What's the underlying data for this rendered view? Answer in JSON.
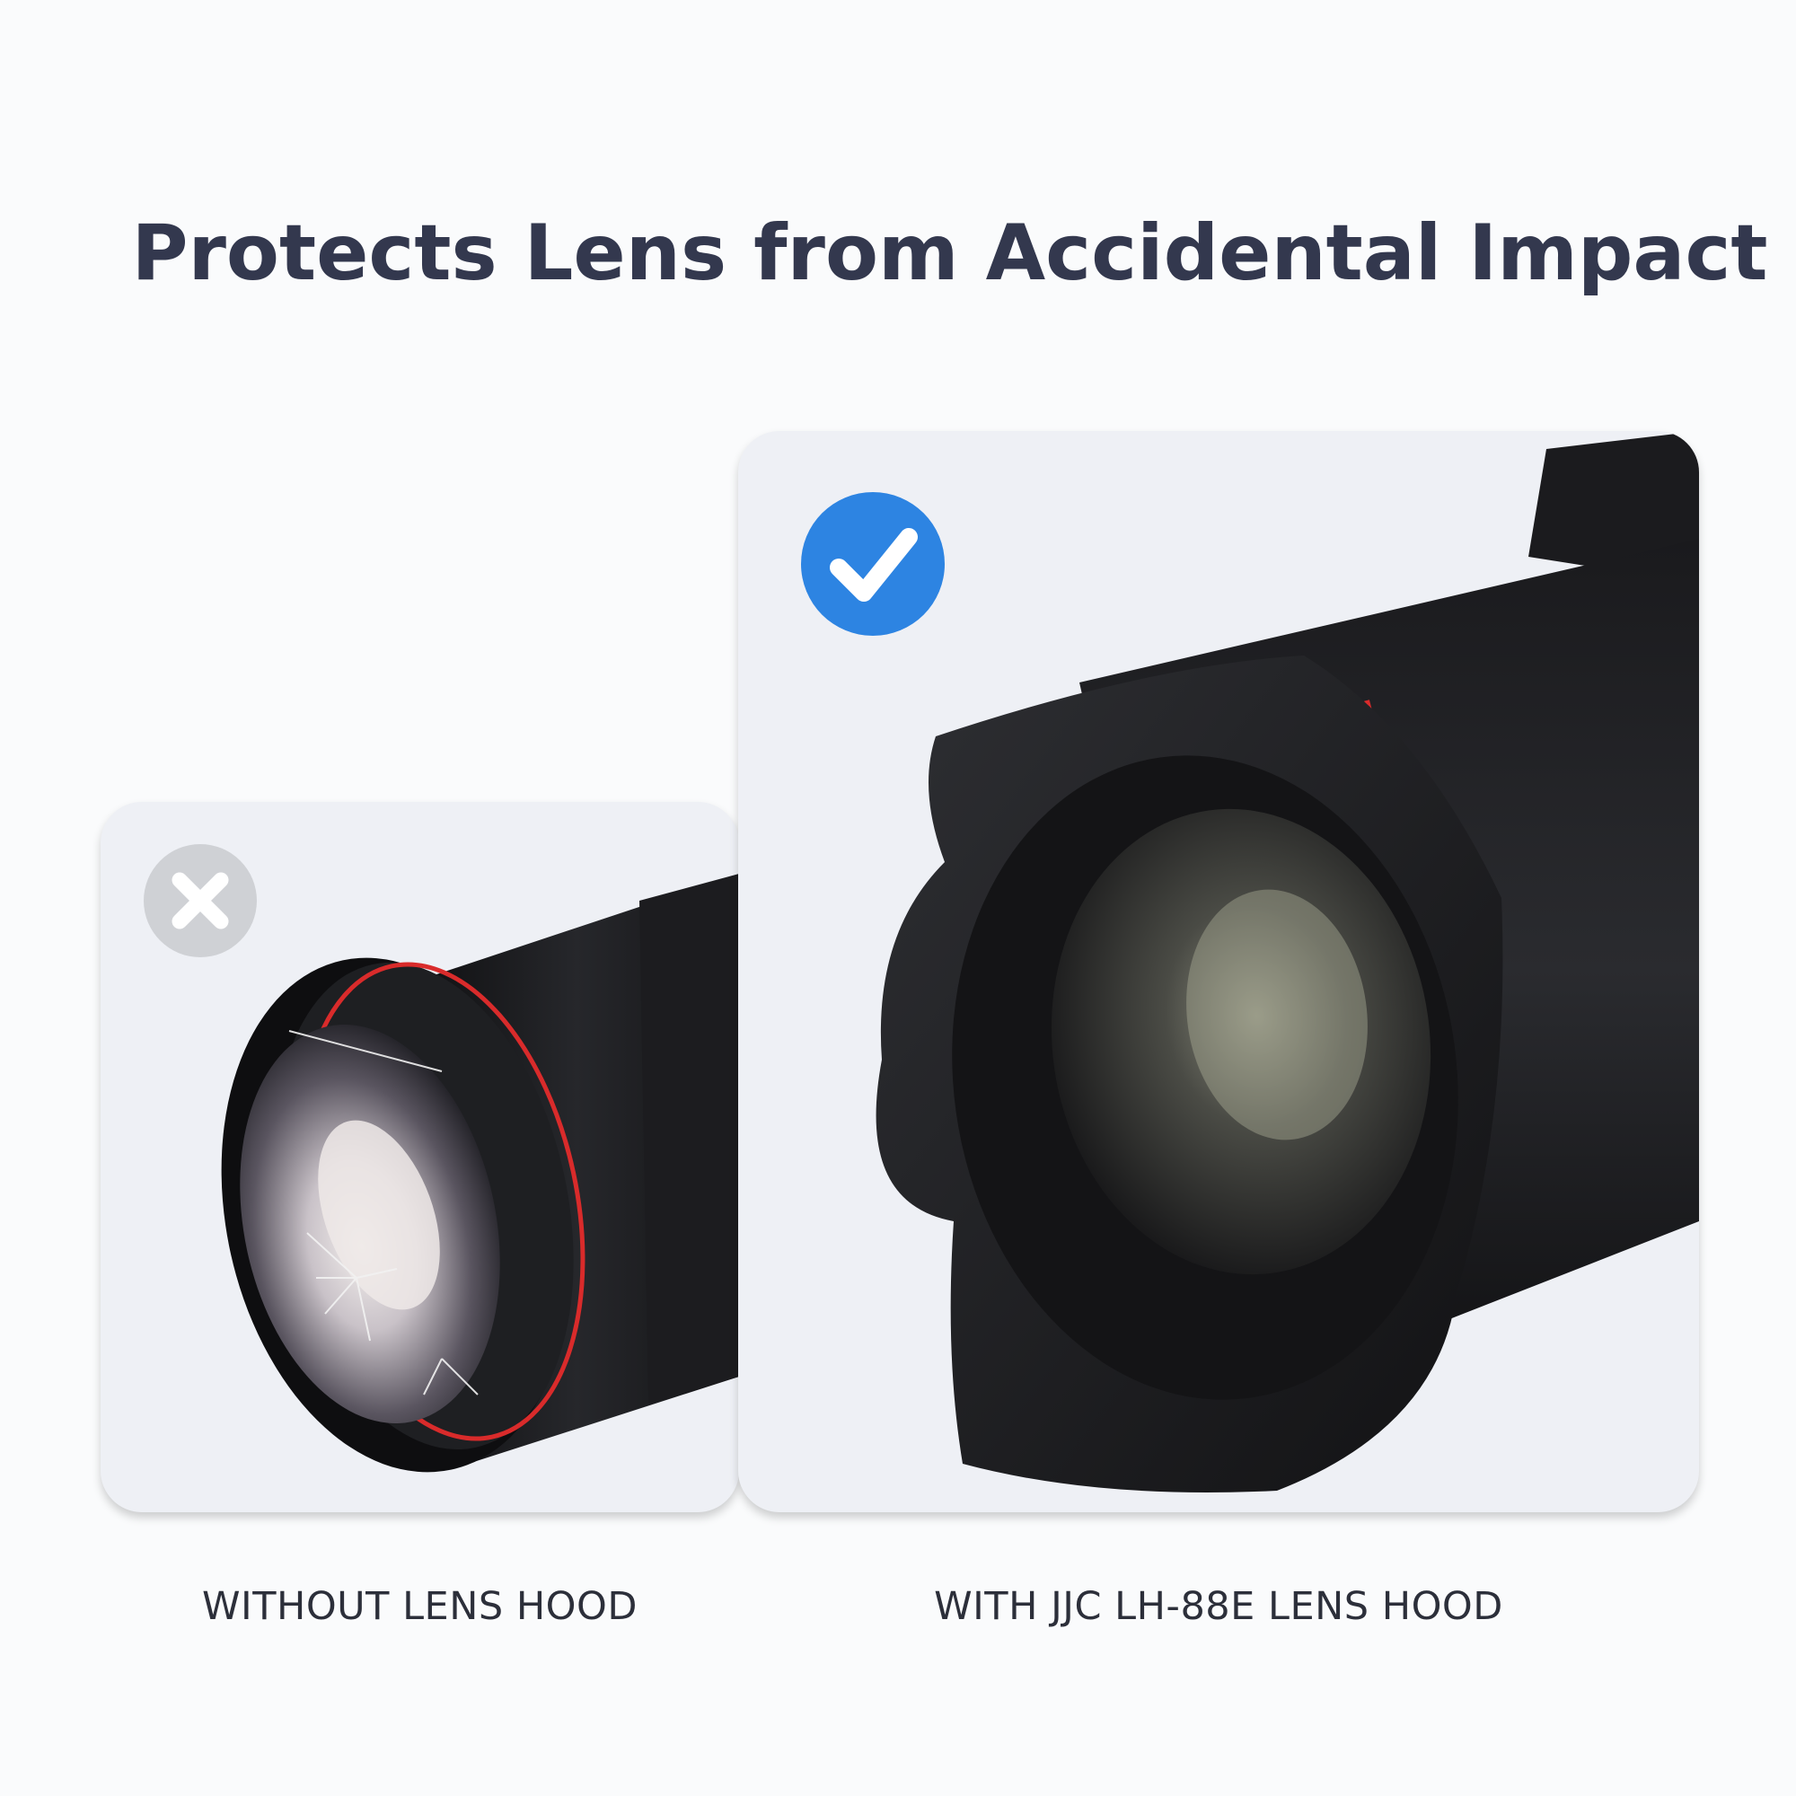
{
  "title": "Protects Lens from Accidental Impact",
  "comparison": {
    "without": {
      "label": "WITHOUT LENS HOOD",
      "badge_icon": "x-icon",
      "badge_color": "#cfd1d5"
    },
    "with": {
      "label": "WITH JJC LH-88E LENS HOOD",
      "badge_icon": "check-icon",
      "badge_color": "#2d84e2"
    }
  },
  "colors": {
    "title": "#33384e",
    "card_bg": "#eef0f5",
    "lens_red_ring": "#d92b2b"
  }
}
